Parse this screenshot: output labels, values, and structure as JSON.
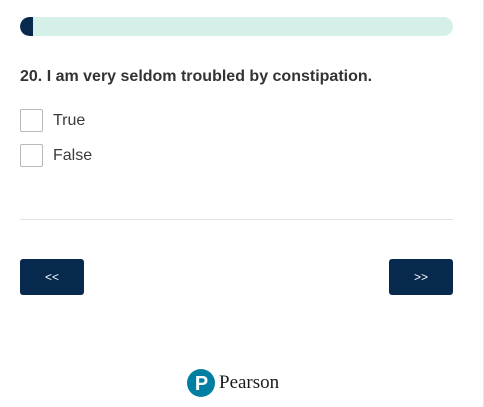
{
  "progress": {
    "fraction": 0.03
  },
  "question": {
    "text": "20. I am very seldom troubled by constipation."
  },
  "options": [
    {
      "label": "True",
      "checked": false
    },
    {
      "label": "False",
      "checked": false
    }
  ],
  "nav": {
    "prev_label": "<<",
    "next_label": ">>"
  },
  "brand": {
    "name": "Pearson",
    "logo_letter": "P",
    "logo_icon": "pearson-logo-icon"
  },
  "colors": {
    "accent": "#06294d",
    "progress_track": "#d5efe9",
    "brand_teal": "#007fa3"
  }
}
